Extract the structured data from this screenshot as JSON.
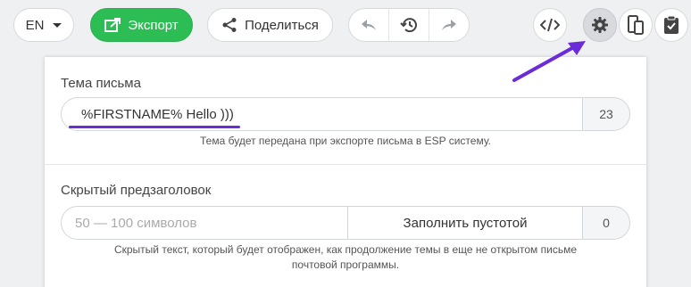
{
  "toolbar": {
    "language": "EN",
    "export_label": "Экспорт",
    "share_label": "Поделиться"
  },
  "subject": {
    "label": "Тема письма",
    "value": "%FIRSTNAME% Hello )))",
    "char_count": "23",
    "hint": "Тема будет передана при экспорте письма в ESP систему."
  },
  "preheader": {
    "label": "Скрытый предзаголовок",
    "placeholder": "50 — 100 символов",
    "fill_button": "Заполнить пустотой",
    "char_count": "0",
    "hint_line1": "Скрытый текст, который будет отображен, как продолжение темы в еще не открытом письме",
    "hint_line2": "почтовой программы."
  },
  "colors": {
    "export_green": "#2dbd55",
    "annotation_purple": "#6a2bd9"
  }
}
